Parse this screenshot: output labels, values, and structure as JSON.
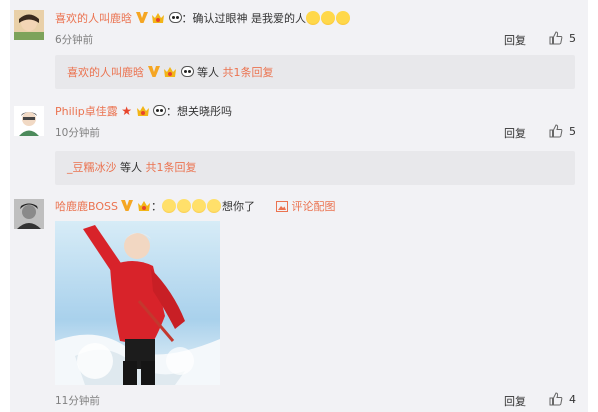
{
  "comments": [
    {
      "username": "喜欢的人叫鹿晗",
      "text": "：确认过眼神 是我爱的人",
      "time": "6分钟前",
      "reply_label": "回复",
      "like_count": "5",
      "sub_reply": {
        "user": "喜欢的人叫鹿晗",
        "middle": " 等人 ",
        "count_link": "共1条回复"
      }
    },
    {
      "username": "Philip卓佳露",
      "text": "：想关晓彤吗",
      "time": "10分钟前",
      "reply_label": "回复",
      "like_count": "5",
      "sub_reply": {
        "user": "_豆糯冰沙",
        "middle": " 等人 ",
        "count_link": "共1条回复"
      }
    },
    {
      "username": "哈鹿鹿BOSS",
      "text_before": "：",
      "text": "想你了",
      "pic_link": "评论配图",
      "time": "11分钟前",
      "reply_label": "回复",
      "like_count": "4"
    }
  ],
  "colors": {
    "name": "#eb7350",
    "panel": "#f2f2f5",
    "subbox": "#e8e8eb"
  }
}
